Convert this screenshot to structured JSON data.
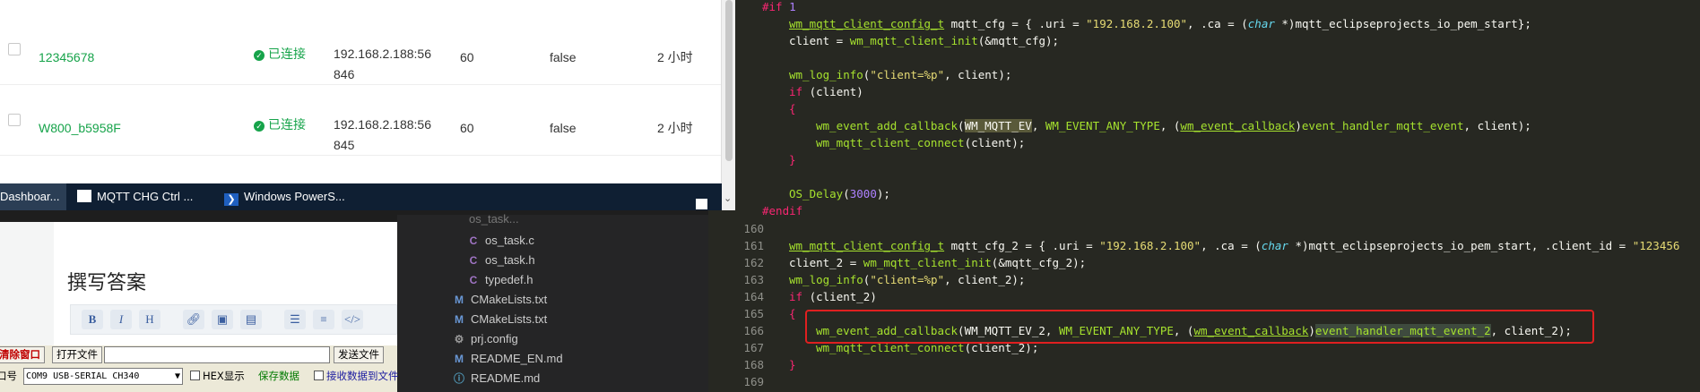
{
  "dashboard": {
    "rows": [
      {
        "client_id": "12345678",
        "status": "已连接",
        "ip_port": "192.168.2.188:56846",
        "keepalive": "60",
        "clean_start": "false",
        "connected_at": "2 小时"
      },
      {
        "client_id": "W800_b5958F",
        "status": "已连接",
        "ip_port": "192.168.2.188:56845",
        "keepalive": "60",
        "clean_start": "false",
        "connected_at": "2 小时"
      }
    ]
  },
  "taskbar": {
    "items": [
      {
        "label": "Dashboar..."
      },
      {
        "label": "MQTT CHG Ctrl ..."
      },
      {
        "label": "Windows PowerS..."
      }
    ]
  },
  "web_editor": {
    "title": "撰写答案",
    "toolbar": [
      "B",
      "I",
      "H",
      "link",
      "image",
      "file",
      "ul",
      "ol",
      "code"
    ]
  },
  "serial_tool": {
    "clear_window": "清除窗口",
    "open_file": "打开文件",
    "send_file": "发送文件",
    "port_label": "口号",
    "port_value": "COM9 USB-SERIAL CH340",
    "hex_display": "HEX显示",
    "save_data": "保存数据",
    "recv_to_file": "接收数据到文件"
  },
  "file_tree": {
    "items": [
      {
        "name": "os_task.c",
        "icon": "c-file-icon",
        "icon_char": "C"
      },
      {
        "name": "os_task.h",
        "icon": "c-header-icon",
        "icon_char": "C"
      },
      {
        "name": "typedef.h",
        "icon": "c-header-icon",
        "icon_char": "C"
      },
      {
        "name": "CMakeLists.txt",
        "icon": "cmake-icon",
        "icon_char": "M"
      },
      {
        "name": "CMakeLists.txt",
        "icon": "cmake-icon",
        "icon_char": "M"
      },
      {
        "name": "prj.config",
        "icon": "gear-icon",
        "icon_char": "⚙"
      },
      {
        "name": "README_EN.md",
        "icon": "markdown-icon",
        "icon_char": "M"
      },
      {
        "name": "README.md",
        "icon": "info-icon",
        "icon_char": "ⓘ"
      }
    ]
  },
  "code": {
    "line_numbers": [
      "160",
      "161",
      "162",
      "163",
      "164",
      "165",
      "166",
      "167",
      "168",
      "169"
    ],
    "theme": {
      "background": "#272822",
      "highlight_box": "#e02020"
    }
  }
}
